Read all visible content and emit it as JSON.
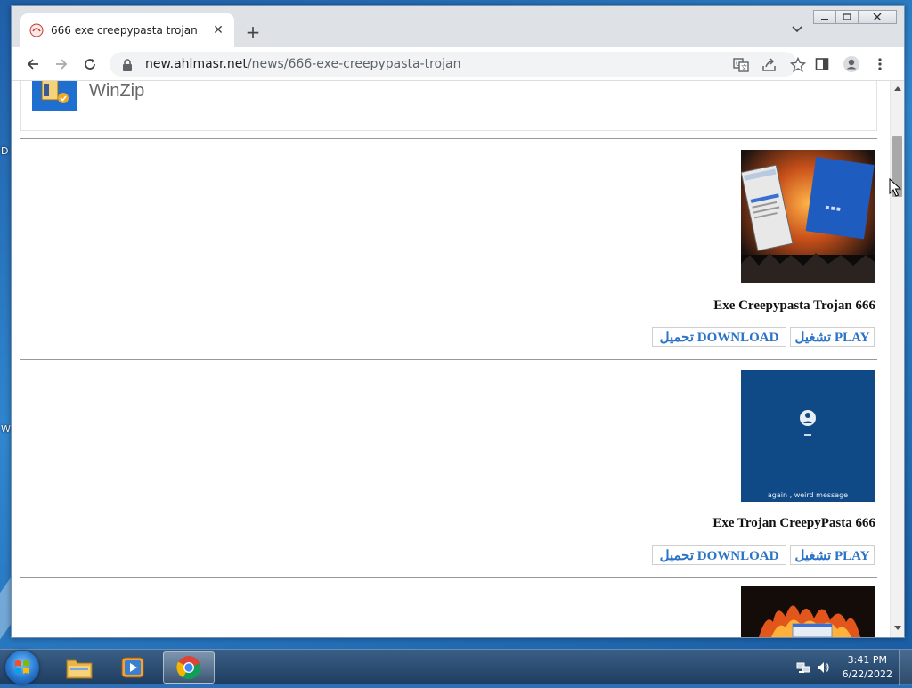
{
  "desktop": {
    "edge_letters": [
      "D",
      "W"
    ]
  },
  "browser": {
    "tab_title": "666 exe creepypasta trojan",
    "new_tab_symbol": "+",
    "tab_close_symbol": "✕",
    "url_host": "new.ahlmasr.net",
    "url_path": "/news/666-exe-creepypasta-trojan",
    "icons": [
      "back-arrow-icon",
      "forward-arrow-icon",
      "reload-icon",
      "lock-icon",
      "translate-icon",
      "share-icon",
      "bookmark-star-icon",
      "side-panel-icon",
      "profile-icon",
      "menu-icon",
      "tab-search-icon"
    ]
  },
  "page": {
    "winzip_label": "WinZip",
    "items": [
      {
        "title": "Exe Creepypasta Trojan 666",
        "download_label": "تحميل DOWNLOAD",
        "play_label": "تشغيل PLAY",
        "thumb_caption": ""
      },
      {
        "title": "Exe Trojan CreepyPasta 666",
        "download_label": "تحميل DOWNLOAD",
        "play_label": "تشغيل PLAY",
        "thumb_caption": "again , weird message"
      }
    ],
    "colors": {
      "link_blue": "#2a73c7",
      "title_black": "#111111"
    }
  },
  "taskbar": {
    "time": "3:41 PM",
    "date": "6/22/2022",
    "items": [
      "file-explorer-icon",
      "media-player-icon",
      "chrome-icon"
    ]
  }
}
